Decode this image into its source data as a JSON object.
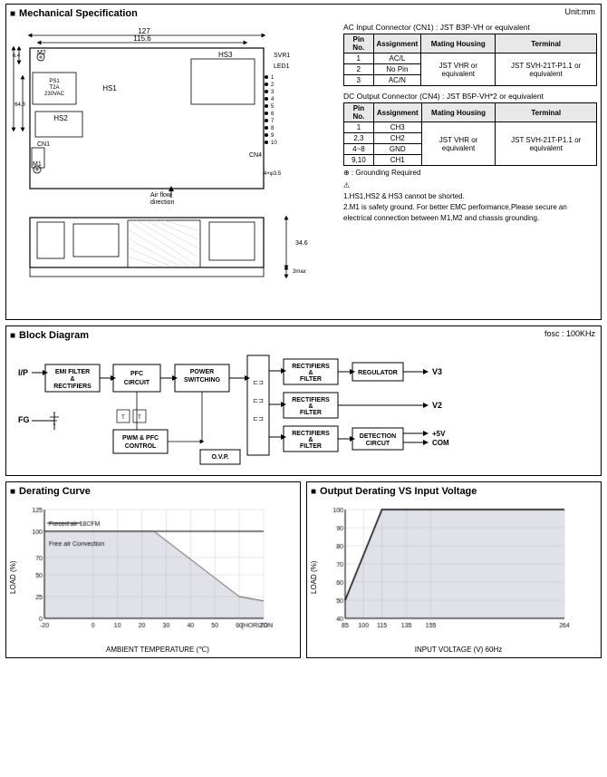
{
  "mechanical": {
    "title": "Mechanical Specification",
    "unit": "Unit:mm",
    "cn1_title": "AC Input Connector (CN1) : JST B3P-VH or equivalent",
    "cn1_columns": [
      "Pin No.",
      "Assignment",
      "Mating Housing",
      "Terminal"
    ],
    "cn1_rows": [
      [
        "1",
        "AC/L",
        "",
        ""
      ],
      [
        "2",
        "No Pin",
        "JST VHR or equivalent",
        "JST SVH-21T-P1.1 or equivalent"
      ],
      [
        "3",
        "AC/N",
        "",
        ""
      ]
    ],
    "cn4_title": "DC Output Connector (CN4) : JST B5P-VH*2 or equivalent",
    "cn4_columns": [
      "Pin No.",
      "Assignment",
      "Mating Housing",
      "Terminal"
    ],
    "cn4_rows": [
      [
        "1",
        "CH3",
        "",
        ""
      ],
      [
        "2,3",
        "CH2",
        "JST VHR or equivalent",
        "JST SVH-21T-P1.1 or equivalent"
      ],
      [
        "4~8",
        "GND",
        "",
        ""
      ],
      [
        "9,10",
        "CH1",
        "",
        ""
      ]
    ],
    "ground_note": "⊕ : Grounding Required",
    "notes": [
      "1.HS1,HS2 & HS3 cannot be shorted.",
      "2.M1 is safety ground. For better EMC performance,Please secure an electrical connection between M1,M2 and chassis grounding."
    ]
  },
  "block": {
    "title": "Block Diagram",
    "fosc": "fosc : 100KHz",
    "boxes": {
      "emi": "EMI FILTER\n&\nRECTIFIERS",
      "pfc": "PFC\nCIRCUIT",
      "power": "POWER\nSWITCHING",
      "pwm": "PWM & PFC\nCONTROL",
      "rect1": "RECTIFIERS\n&\nFILTER",
      "rect2": "RECTIFIERS\n&\nFILTER",
      "rect3": "RECTIFIERS\n&\nFILTER",
      "regulator": "REGULATOR",
      "detection": "DETECTION\nCIRCUT",
      "ovp": "O.V.P.",
      "ip": "I/P",
      "fg": "FG",
      "v3": "V3",
      "v2": "V2",
      "v5": "+5V",
      "com": "COM"
    }
  },
  "derating": {
    "title": "Derating Curve",
    "y_label": "LOAD (%)",
    "x_label": "AMBIENT TEMPERATURE (℃)",
    "legend_forced": "Forced air 18CFM",
    "legend_free": "Free air Convection",
    "y_ticks": [
      0,
      25,
      50,
      70,
      100,
      125
    ],
    "x_ticks": [
      -20,
      0,
      10,
      20,
      30,
      40,
      50,
      60,
      70
    ],
    "x_label_horizontal": "(HORIZONTAL)"
  },
  "output_derating": {
    "title": "Output Derating VS Input Voltage",
    "y_label": "LOAD (%)",
    "x_label": "INPUT VOLTAGE (V) 60Hz",
    "y_ticks": [
      40,
      50,
      60,
      70,
      80,
      90,
      100
    ],
    "x_ticks": [
      85,
      100,
      115,
      135,
      155,
      264
    ]
  }
}
